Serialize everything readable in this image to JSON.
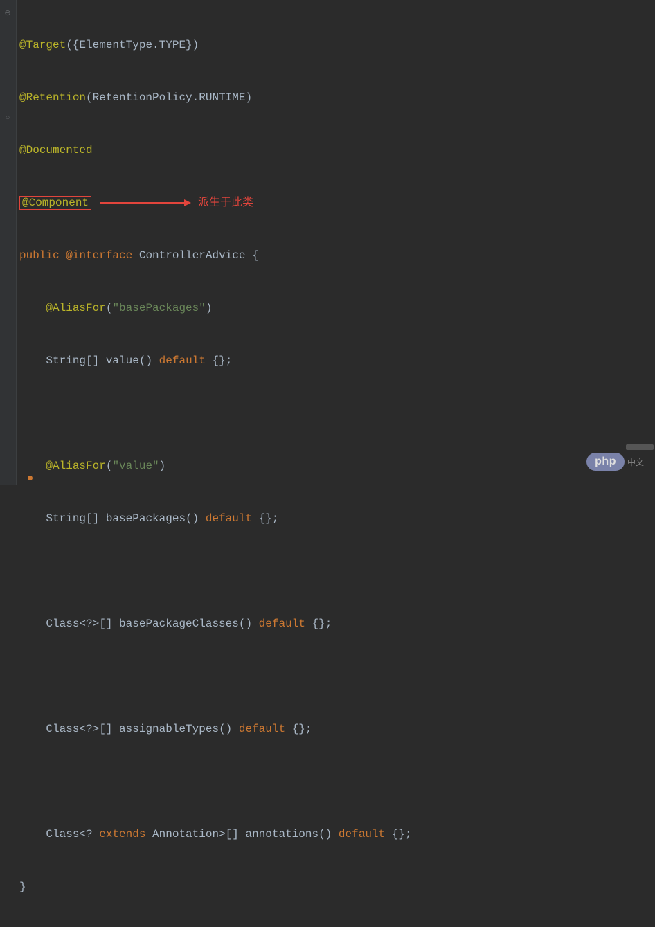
{
  "annotations": {
    "target": "@Target",
    "target_args": "({ElementType.TYPE})",
    "retention": "@Retention",
    "retention_args": "(RetentionPolicy.RUNTIME)",
    "documented": "@Documented",
    "component": "@Component",
    "aliasfor": "@AliasFor"
  },
  "arrow_label": "派生于此类",
  "keywords": {
    "public": "public",
    "interface_at": "@interface",
    "default": "default",
    "extends": "extends"
  },
  "type_name": "ControllerAdvice",
  "methods": {
    "value": {
      "alias_arg": "\"basePackages\"",
      "return_type": "String[]",
      "name": "value",
      "default": "{}"
    },
    "basePackages": {
      "alias_arg": "\"value\"",
      "return_type": "String[]",
      "name": "basePackages",
      "default": "{}"
    },
    "basePackageClasses": {
      "return_type": "Class<?>[]",
      "name": "basePackageClasses",
      "default": "{}"
    },
    "assignableTypes": {
      "return_type": "Class<?>[]",
      "name": "assignableTypes",
      "default": "{}"
    },
    "annotations": {
      "return_prefix": "Class<? ",
      "return_suffix": " Annotation>[]",
      "name": "annotations",
      "default": "{}"
    }
  },
  "watermark": {
    "php": "php",
    "cn": "中文"
  },
  "parens": {
    "open": "(",
    "close": ")",
    "brace_open": "{",
    "brace_close": "}",
    "semi": ";",
    "space": " "
  }
}
